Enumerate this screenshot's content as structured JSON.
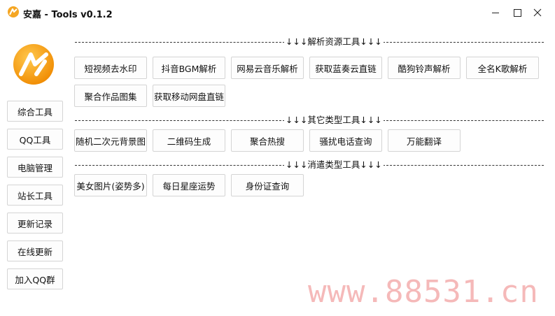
{
  "window": {
    "title": "安嘉 - Tools v0.1.2",
    "accent_color": "#f5a623",
    "controls": {
      "minimize_icon": "minimize-icon",
      "maximize_icon": "maximize-icon",
      "close_icon": "close-icon"
    }
  },
  "sidebar": {
    "items": [
      {
        "label": "综合工具"
      },
      {
        "label": "QQ工具"
      },
      {
        "label": "电脑管理"
      },
      {
        "label": "站长工具"
      },
      {
        "label": "更新记录"
      },
      {
        "label": "在线更新"
      },
      {
        "label": "加入QQ群"
      }
    ]
  },
  "sections": [
    {
      "header": "↓↓↓解析资源工具↓↓↓",
      "tools": [
        "短视频去水印",
        "抖音BGM解析",
        "网易云音乐解析",
        "获取蓝奏云直链",
        "酷狗铃声解析",
        "全名K歌解析",
        "聚合作品图集",
        "获取移动网盘直链"
      ]
    },
    {
      "header": "↓↓↓其它类型工具↓↓↓",
      "tools": [
        "随机二次元背景图",
        "二维码生成",
        "聚合热搜",
        "骚扰电话查询",
        "万能翻译"
      ]
    },
    {
      "header": "↓↓↓消遣类型工具↓↓↓",
      "tools": [
        "美女图片(姿势多)",
        "每日星座运势",
        "身份证查询"
      ]
    }
  ],
  "watermark": "www.88531.cn"
}
